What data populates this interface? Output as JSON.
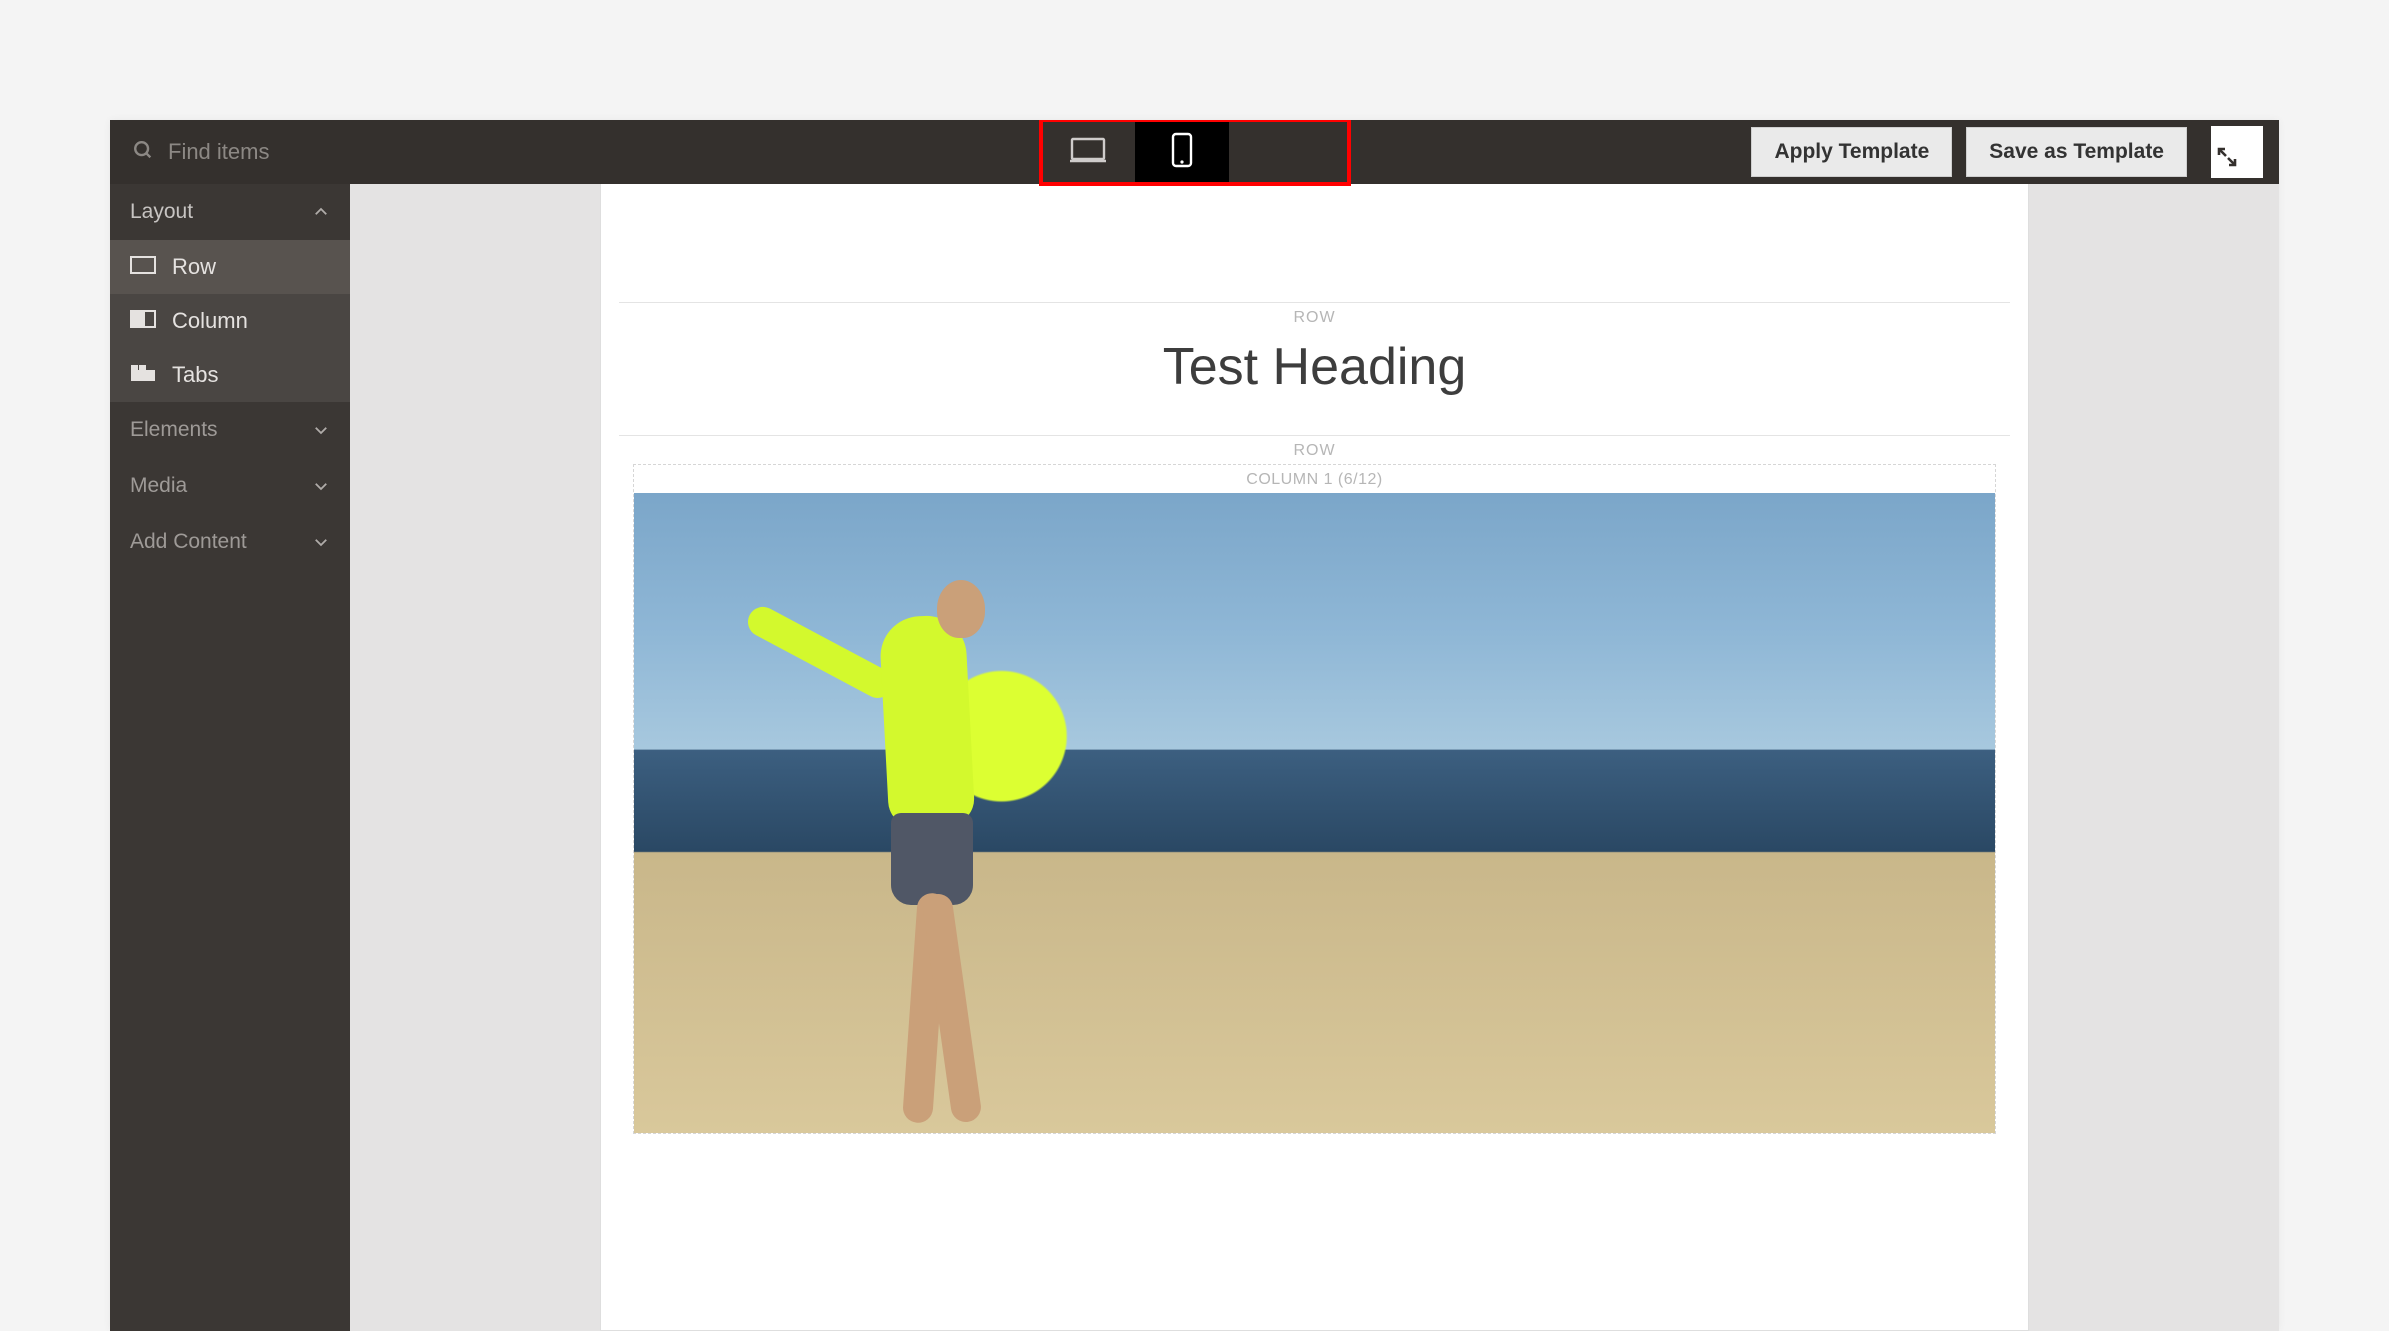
{
  "topbar": {
    "search_placeholder": "Find items",
    "apply_template": "Apply Template",
    "save_template": "Save as Template",
    "viewports": {
      "desktop_active": false,
      "mobile_active": true
    }
  },
  "sidebar": {
    "groups": [
      {
        "label": "Layout",
        "expanded": true,
        "items": [
          {
            "label": "Row",
            "icon": "row-icon",
            "active": true
          },
          {
            "label": "Column",
            "icon": "column-icon",
            "active": false
          },
          {
            "label": "Tabs",
            "icon": "tabs-icon",
            "active": false
          }
        ]
      },
      {
        "label": "Elements",
        "expanded": false
      },
      {
        "label": "Media",
        "expanded": false
      },
      {
        "label": "Add Content",
        "expanded": false
      }
    ]
  },
  "canvas": {
    "row1_label": "ROW",
    "heading": "Test Heading",
    "row2_label": "ROW",
    "column_label": "COLUMN 1 (6/12)"
  }
}
